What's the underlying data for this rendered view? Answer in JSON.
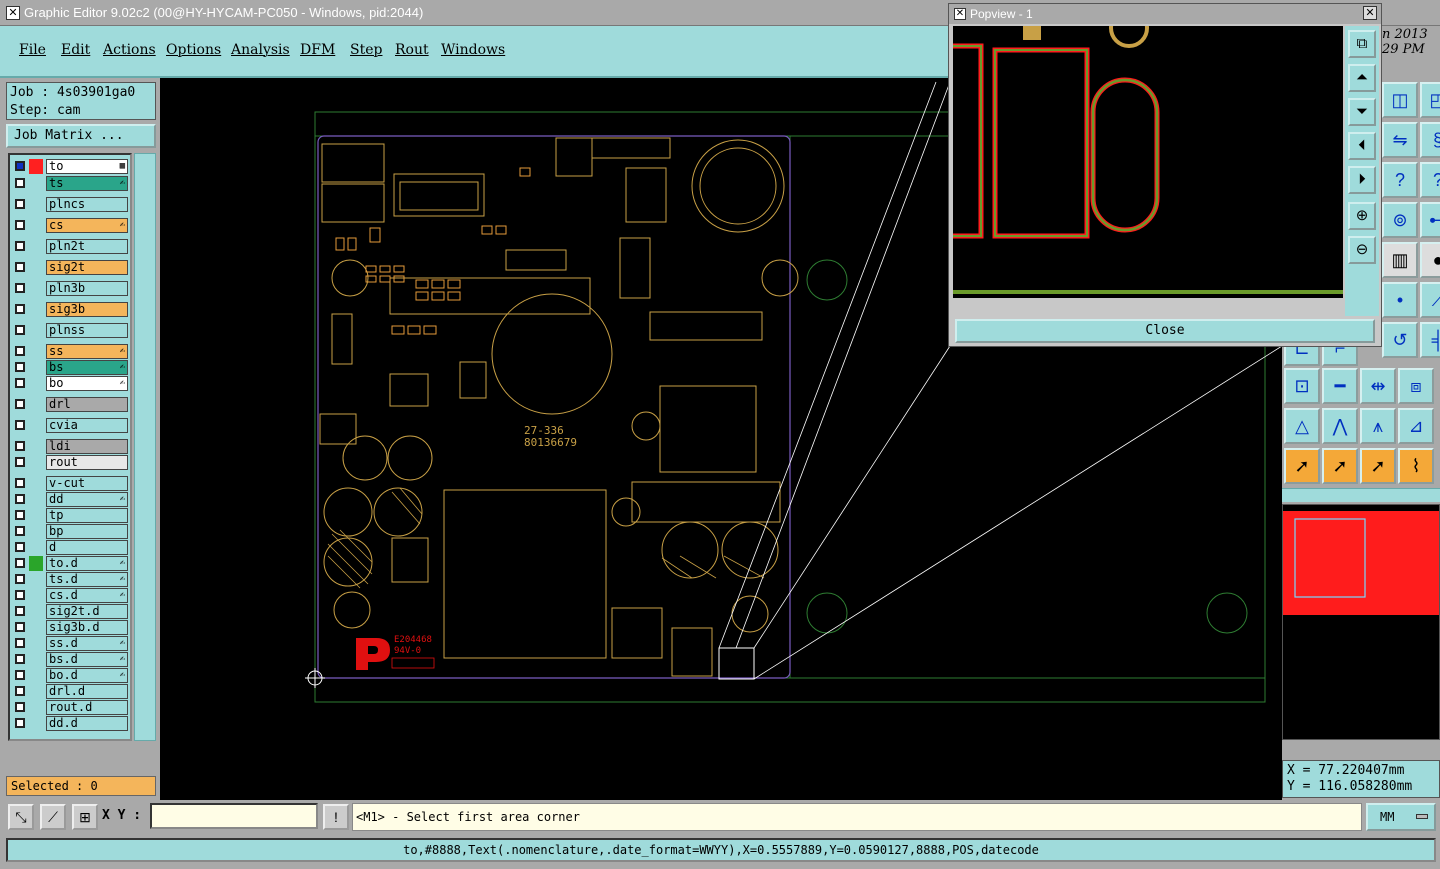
{
  "window": {
    "title": "Graphic Editor 9.02c2 (00@HY-HYCAM-PC050 - Windows, pid:2044)"
  },
  "menu": [
    "File",
    "Edit",
    "Actions",
    "Options",
    "Analysis",
    "DFM",
    "Step",
    "Rout",
    "Windows"
  ],
  "job": {
    "job_line": "Job : 4s03901ga0",
    "step_line": "Step: cam",
    "matrix_button": "Job Matrix ..."
  },
  "layers": [
    {
      "name": "to",
      "color": "#ffffff",
      "mark": "▦",
      "swatch": "#ff2020",
      "active": true
    },
    {
      "name": "ts",
      "color": "#2aa58a",
      "mark": "✍",
      "swatch": "",
      "active": false
    },
    {
      "name": "plncs",
      "color": "#9fdbdb",
      "mark": "",
      "swatch": "",
      "active": false
    },
    {
      "name": "cs",
      "color": "#f4b55b",
      "mark": "✍",
      "swatch": "",
      "active": false
    },
    {
      "name": "pln2t",
      "color": "#9fdbdb",
      "mark": "",
      "swatch": "",
      "active": false
    },
    {
      "name": "sig2t",
      "color": "#f4b55b",
      "mark": "",
      "swatch": "",
      "active": false
    },
    {
      "name": "pln3b",
      "color": "#9fdbdb",
      "mark": "",
      "swatch": "",
      "active": false
    },
    {
      "name": "sig3b",
      "color": "#f4b55b",
      "mark": "",
      "swatch": "",
      "active": false
    },
    {
      "name": "plnss",
      "color": "#9fdbdb",
      "mark": "",
      "swatch": "",
      "active": false
    },
    {
      "name": "ss",
      "color": "#f4b55b",
      "mark": "✍",
      "swatch": "",
      "active": false
    },
    {
      "name": "bs",
      "color": "#2aa58a",
      "mark": "✍",
      "swatch": "",
      "active": false
    },
    {
      "name": "bo",
      "color": "#ffffff",
      "mark": "✍",
      "swatch": "",
      "active": false
    },
    {
      "name": "drl",
      "color": "#a9a9a9",
      "mark": "",
      "swatch": "",
      "active": false
    },
    {
      "name": "cvia",
      "color": "#9fdbdb",
      "mark": "",
      "swatch": "",
      "active": false
    },
    {
      "name": "ldi",
      "color": "#a9a9a9",
      "mark": "",
      "swatch": "",
      "active": false
    },
    {
      "name": "rout",
      "color": "#e8e8e8",
      "mark": "",
      "swatch": "",
      "active": false
    },
    {
      "name": "v-cut",
      "color": "#9fdbdb",
      "mark": "",
      "swatch": "",
      "active": false
    },
    {
      "name": "dd",
      "color": "#9fdbdb",
      "mark": "✍",
      "swatch": "",
      "active": false
    },
    {
      "name": "tp",
      "color": "#9fdbdb",
      "mark": "",
      "swatch": "",
      "active": false
    },
    {
      "name": "bp",
      "color": "#9fdbdb",
      "mark": "",
      "swatch": "",
      "active": false
    },
    {
      "name": "d",
      "color": "#9fdbdb",
      "mark": "",
      "swatch": "",
      "active": false
    },
    {
      "name": "to.d",
      "color": "#9fdbdb",
      "mark": "✍",
      "swatch": "#2aa52a",
      "active": false
    },
    {
      "name": "ts.d",
      "color": "#9fdbdb",
      "mark": "✍",
      "swatch": "",
      "active": false
    },
    {
      "name": "cs.d",
      "color": "#9fdbdb",
      "mark": "✍",
      "swatch": "",
      "active": false
    },
    {
      "name": "sig2t.d",
      "color": "#9fdbdb",
      "mark": "",
      "swatch": "",
      "active": false
    },
    {
      "name": "sig3b.d",
      "color": "#9fdbdb",
      "mark": "",
      "swatch": "",
      "active": false
    },
    {
      "name": "ss.d",
      "color": "#9fdbdb",
      "mark": "✍",
      "swatch": "",
      "active": false
    },
    {
      "name": "bs.d",
      "color": "#9fdbdb",
      "mark": "✍",
      "swatch": "",
      "active": false
    },
    {
      "name": "bo.d",
      "color": "#9fdbdb",
      "mark": "✍",
      "swatch": "",
      "active": false
    },
    {
      "name": "drl.d",
      "color": "#9fdbdb",
      "mark": "",
      "swatch": "",
      "active": false
    },
    {
      "name": "rout.d",
      "color": "#9fdbdb",
      "mark": "",
      "swatch": "",
      "active": false
    },
    {
      "name": "dd.d",
      "color": "#9fdbdb",
      "mark": "",
      "swatch": "",
      "active": false
    }
  ],
  "selected": "Selected : 0",
  "popview": {
    "title": "Popview - 1",
    "close_label": "Close",
    "close_x": "✕"
  },
  "date_text": {
    "line1": "n 2013",
    "line2": "29 PM"
  },
  "board_text": {
    "part1": "27-336",
    "part2": "80136679",
    "ul1": "E204468",
    "ul2": "94V-0"
  },
  "coords": {
    "x": "X =  77.220407mm",
    "y": "Y = 116.058280mm"
  },
  "bottom": {
    "xy_label": "X Y :",
    "xy_value": "",
    "prompt": "<M1> - Select first area corner",
    "units": "MM",
    "bang": "!"
  },
  "status": "to,#8888,Text(.nomenclature,.date_format=WWYY),X=0.5557889,Y=0.0590127,8888,POS,datecode",
  "colors": {
    "teal": "#9fdbdb",
    "orange": "#f4b55b",
    "silk": "#c8a046",
    "outline": "#7a5cc0",
    "green": "#2e7d32",
    "red": "#ff1c1c"
  },
  "icons": {
    "popview_tools": [
      "fit-icon",
      "pan-up-icon",
      "pan-down-icon",
      "pan-left-icon",
      "pan-right-icon",
      "zoom-in-icon",
      "zoom-out-icon"
    ]
  }
}
